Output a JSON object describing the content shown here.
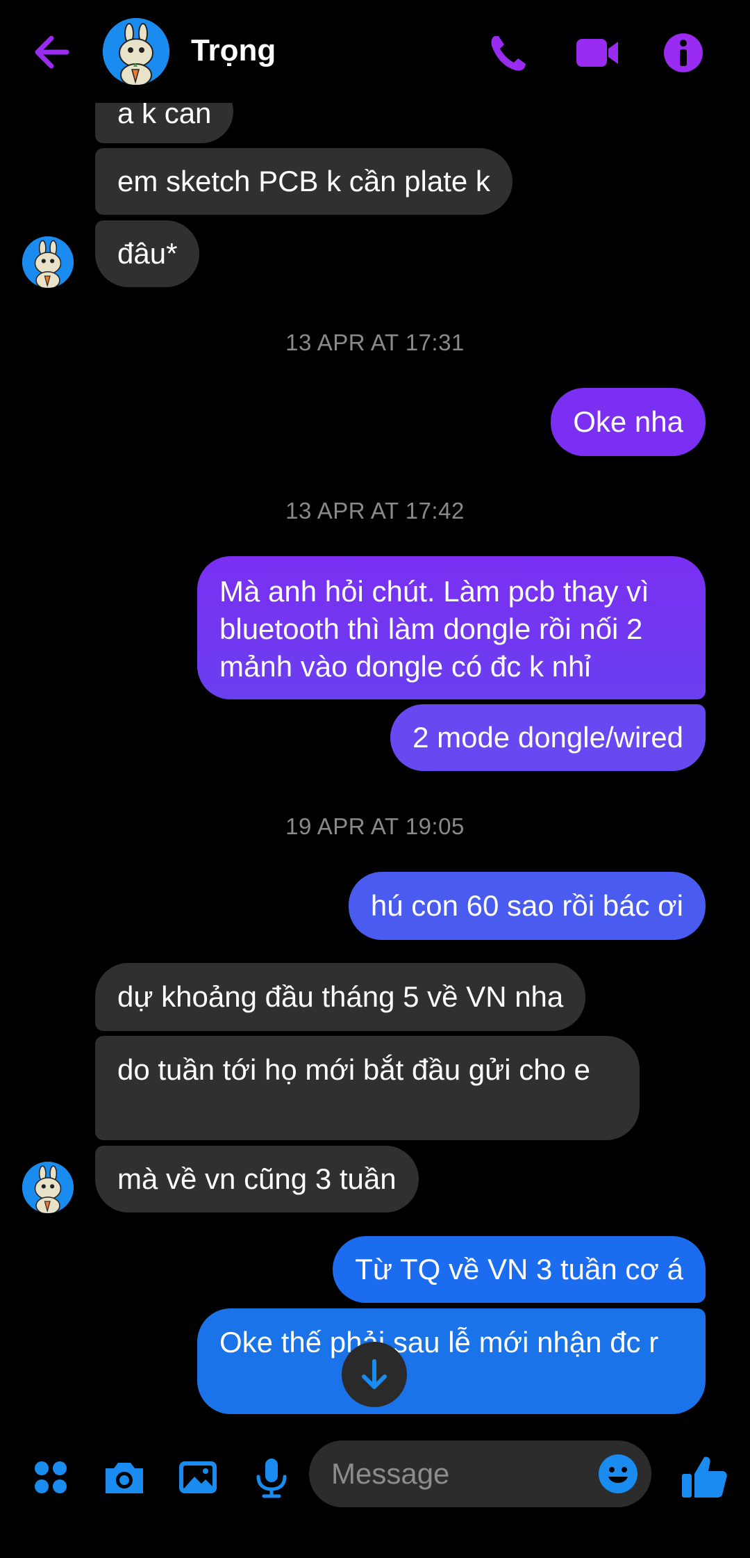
{
  "header": {
    "contact_name": "Trọng",
    "back_icon": "back-arrow-icon",
    "icons": [
      "phone-icon",
      "video-icon",
      "info-icon"
    ]
  },
  "messages": [
    {
      "side": "in",
      "text": "a k can"
    },
    {
      "side": "in",
      "text": "em sketch PCB k cần plate k"
    },
    {
      "side": "in",
      "text": "đâu*"
    },
    {
      "timestamp": "13 APR AT 17:31"
    },
    {
      "side": "out",
      "text": "Oke nha"
    },
    {
      "timestamp": "13 APR AT 17:42"
    },
    {
      "side": "out",
      "text": "Mà anh hỏi chút. Làm pcb thay vì bluetooth thì làm dongle rồi nối 2 mảnh vào dongle có đc k nhỉ"
    },
    {
      "side": "out",
      "text": "2 mode dongle/wired"
    },
    {
      "timestamp": "19 APR AT 19:05"
    },
    {
      "side": "out",
      "text": "hú con 60 sao rồi bác ơi"
    },
    {
      "side": "in",
      "text": "dự khoảng đầu tháng 5 về VN nha"
    },
    {
      "side": "in",
      "text": "do tuần tới họ mới bắt đầu gửi cho e"
    },
    {
      "side": "in",
      "text": "mà về vn cũng 3 tuần"
    },
    {
      "side": "out",
      "text": "Từ TQ về VN 3 tuần cơ á"
    },
    {
      "side": "out",
      "text": "Oke thế phải sau lễ mới nhận đc r"
    }
  ],
  "composer": {
    "placeholder": "Message",
    "icons": [
      "apps-icon",
      "camera-icon",
      "image-icon",
      "microphone-icon",
      "emoji-icon",
      "thumbs-up-icon"
    ]
  },
  "colors": {
    "accent": "#8a2be2",
    "incoming_bubble": "#303030",
    "outgoing_purple": "#7b2ff2",
    "outgoing_blue": "#1a73e8",
    "composer_blue": "#1a8cf0"
  }
}
